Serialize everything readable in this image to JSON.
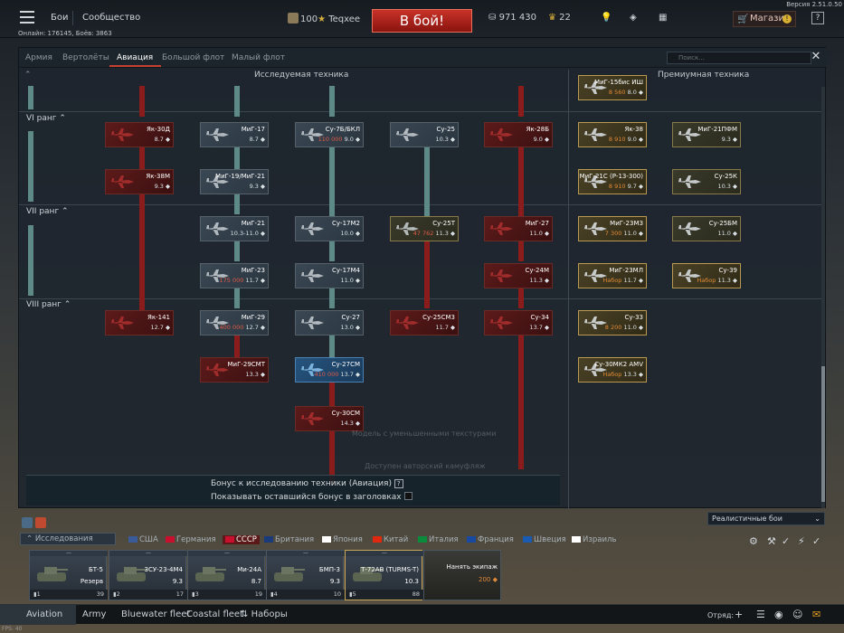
{
  "topbar": {
    "battles_label": "Бои",
    "community_label": "Сообщество",
    "profile_level": "100",
    "profile_name": "Teqxee",
    "battle_button": "В бой!",
    "silver": "971 430",
    "gold": "22",
    "shop_label": "Магазин",
    "help_label": "?",
    "version": "Версия 2.51.0.50",
    "online": "Онлайн: 176145, Боёв: 3863"
  },
  "tabs": [
    {
      "label": "Армия"
    },
    {
      "label": "Вертолёты"
    },
    {
      "label": "Авиация"
    },
    {
      "label": "Большой флот"
    },
    {
      "label": "Малый флот"
    }
  ],
  "search_placeholder": "Поиск...",
  "headers": {
    "research": "Исследуемая техника",
    "premium": "Премиумная техника"
  },
  "ranks": [
    "VI ранг",
    "VII ранг",
    "VIII ранг"
  ],
  "research_cards": [
    {
      "name": "Як-30Д",
      "br": "8.7"
    },
    {
      "name": "Як-38М",
      "br": "9.3"
    },
    {
      "name": "Як-141",
      "br": "12.7"
    },
    {
      "name": "МиГ-17",
      "br": "8.7"
    },
    {
      "name": "МиГ-19/МиГ-21",
      "br": "9.3"
    },
    {
      "name": "МиГ-21",
      "br": "10.3-11.0"
    },
    {
      "name": "МиГ-23",
      "br": "11.7",
      "rp": "175 000"
    },
    {
      "name": "МиГ-29",
      "br": "12.7",
      "rp": "400 000"
    },
    {
      "name": "МиГ-29СМТ",
      "br": "13.3"
    },
    {
      "name": "Су-7Б/БКЛ",
      "br": "9.0",
      "rp": "110 000"
    },
    {
      "name": "Су-17М2",
      "br": "10.0"
    },
    {
      "name": "Су-17М4",
      "br": "11.0"
    },
    {
      "name": "Су-27",
      "br": "13.0"
    },
    {
      "name": "Су-27СМ",
      "br": "13.7",
      "rp": "410 000"
    },
    {
      "name": "Су-30СМ",
      "br": "14.3"
    },
    {
      "name": "Су-25",
      "br": "10.3"
    },
    {
      "name": "Су-25Т",
      "br": "11.3",
      "rp": "47 762"
    },
    {
      "name": "Су-25СМ3",
      "br": "11.7"
    },
    {
      "name": "Як-28Б",
      "br": "9.0"
    },
    {
      "name": "МиГ-27",
      "br": "11.0"
    },
    {
      "name": "Су-24М",
      "br": "11.3"
    },
    {
      "name": "Су-34",
      "br": "13.7"
    }
  ],
  "premium_cards": [
    {
      "name": "МиГ-15бис ИШ",
      "br": "8.0",
      "price": "8 560"
    },
    {
      "name": "Як-38",
      "br": "9.0",
      "price": "8 910"
    },
    {
      "name": "МиГ-21ПФМ",
      "br": "9.3"
    },
    {
      "name": "МиГ-21С (Р-13-300)",
      "br": "9.7",
      "price": "8 910"
    },
    {
      "name": "Су-25К",
      "br": "10.3"
    },
    {
      "name": "МиГ-23МЗ",
      "br": "11.0",
      "price": "7 300"
    },
    {
      "name": "Су-25БМ",
      "br": "11.0"
    },
    {
      "name": "МиГ-23МЛ",
      "br": "11.7",
      "price": "Набор"
    },
    {
      "name": "Су-39",
      "br": "11.3",
      "price": "Набор"
    },
    {
      "name": "Су-33",
      "br": "11.0",
      "price": "8 200"
    },
    {
      "name": "Су-30МК2 AMV",
      "br": "13.3",
      "price": "Набор"
    }
  ],
  "bonus": {
    "line1": "Бонус к исследованию техники (Авиация)",
    "line2": "Показывать оставшийся бонус в заголовках",
    "ghost1": "Модель с уменьшенными текстурами",
    "ghost2": "Доступен авторский камуфляж"
  },
  "game_mode": "Реалистичные бои",
  "country_bar": {
    "research_label": "Исследования",
    "countries": [
      "США",
      "Германия",
      "СССР",
      "Британия",
      "Япония",
      "Китай",
      "Италия",
      "Франция",
      "Швеция",
      "Израиль"
    ]
  },
  "crew_slots": [
    {
      "name": "БТ-5",
      "sub": "Резерв",
      "num": "1",
      "br": "39"
    },
    {
      "name": "ЗСУ-23-4М4",
      "sub": "9.3",
      "num": "2",
      "br": "17"
    },
    {
      "name": "Ми-24А",
      "sub": "8.7",
      "num": "3",
      "br": "19"
    },
    {
      "name": "БМП-3",
      "sub": "9.3",
      "num": "4",
      "br": "10"
    },
    {
      "name": "Т-72АВ (TURMS-T)",
      "sub": "10.3",
      "num": "5",
      "br": "88"
    },
    {
      "name": "Нанять экипаж",
      "sub": "200"
    }
  ],
  "bottom_bar": {
    "items": [
      "Aviation",
      "Army",
      "Bluewater fleet",
      "Coastal fleet",
      "Наборы"
    ],
    "squad_label": "Отряд:"
  },
  "fps": "FPS: 40",
  "colors": {
    "accent": "#c84030",
    "research_arrow": "#5d8a86",
    "locked_arrow": "#8a1c1c"
  }
}
